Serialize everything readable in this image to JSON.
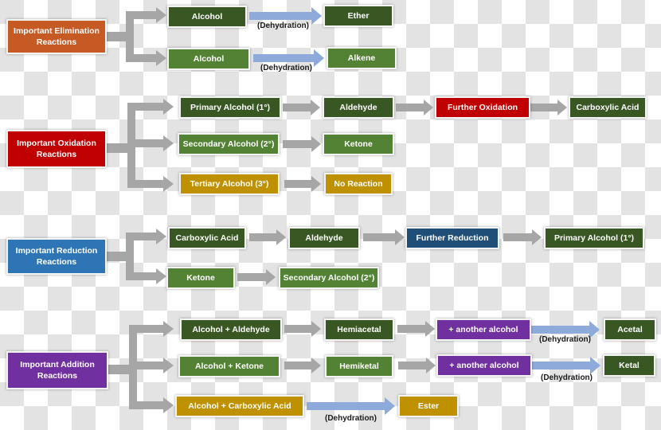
{
  "colors": {
    "elimination": "#c55a24",
    "oxidation": "#c00000",
    "reduction": "#2e75b6",
    "addition": "#7030a0",
    "dark_green": "#385723",
    "green": "#548235",
    "gold": "#bf9000",
    "navy": "#1f4e79",
    "connector_gray": "#a6a6a6",
    "dehydration_arrow_blue": "#8eaadb"
  },
  "elimination": {
    "title": "Important Elimination Reactions",
    "rows": [
      {
        "from": "Alcohol",
        "to": "Ether",
        "arrow_label": "(Dehydration)"
      },
      {
        "from": "Alcohol",
        "to": "Alkene",
        "arrow_label": "(Dehydration)"
      }
    ]
  },
  "oxidation": {
    "title": "Important Oxidation Reactions",
    "rows": [
      {
        "steps": [
          "Primary Alcohol (1°)",
          "Aldehyde",
          "Further Oxidation",
          "Carboxylic Acid"
        ]
      },
      {
        "steps": [
          "Secondary Alcohol (2°)",
          "Ketone"
        ]
      },
      {
        "steps": [
          "Tertiary Alcohol (3°)",
          "No Reaction"
        ]
      }
    ]
  },
  "reduction": {
    "title": "Important Reduction Reactions",
    "rows": [
      {
        "steps": [
          "Carboxylic Acid",
          "Aldehyde",
          "Further Reduction",
          "Primary Alcohol (1°)"
        ]
      },
      {
        "steps": [
          "Ketone",
          "Secondary Alcohol (2°)"
        ]
      }
    ]
  },
  "addition": {
    "title": "Important Addition Reactions",
    "rows": [
      {
        "steps": [
          "Alcohol + Aldehyde",
          "Hemiacetal",
          "+ another alcohol",
          "Acetal"
        ],
        "arrow_label": "(Dehydration)"
      },
      {
        "steps": [
          "Alcohol + Ketone",
          "Hemiketal",
          "+ another alcohol",
          "Ketal"
        ],
        "arrow_label": "(Dehydration)"
      },
      {
        "steps": [
          "Alcohol + Carboxylic Acid",
          "Ester"
        ],
        "arrow_label": "(Dehydration)"
      }
    ]
  }
}
